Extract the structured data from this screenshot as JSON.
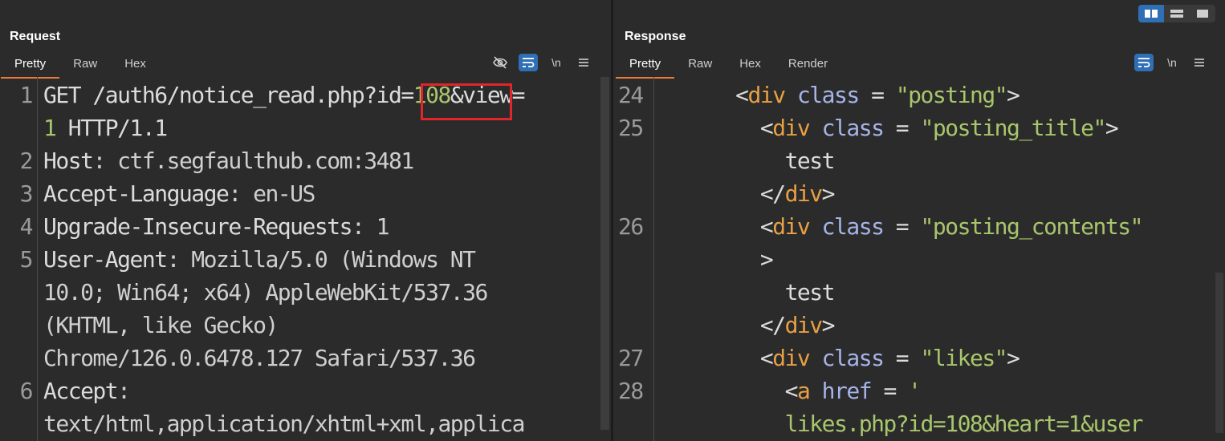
{
  "request": {
    "title": "Request",
    "tabs": [
      "Pretty",
      "Raw",
      "Hex"
    ],
    "icons": [
      "eye-slash-icon",
      "wrap-icon",
      "newline-icon",
      "menu-icon"
    ],
    "newline_label": "\\n",
    "line_numbers": [
      "1",
      "",
      "2",
      "3",
      "4",
      "5",
      "",
      "",
      "",
      "6",
      ""
    ],
    "lines": [
      [
        {
          "t": "GET /auth6/notice_read.php?",
          "c": "k"
        },
        {
          "t": "id=",
          "c": "k"
        },
        {
          "t": "108",
          "c": "g"
        },
        {
          "t": "&view=",
          "c": "k"
        }
      ],
      [
        {
          "t": "1",
          "c": "g"
        },
        {
          "t": " HTTP/1.1",
          "c": "k"
        }
      ],
      [
        {
          "t": "Host",
          "c": "k"
        },
        {
          "t": ": ctf.segfaulthub.com:3481",
          "c": "v"
        }
      ],
      [
        {
          "t": "Accept-Language",
          "c": "k"
        },
        {
          "t": ": en-US",
          "c": "v"
        }
      ],
      [
        {
          "t": "Upgrade-Insecure-Requests",
          "c": "k"
        },
        {
          "t": ": 1",
          "c": "v"
        }
      ],
      [
        {
          "t": "User-Agent",
          "c": "k"
        },
        {
          "t": ": Mozilla/5.0 (Windows NT",
          "c": "v"
        }
      ],
      [
        {
          "t": "10.0; Win64; x64) AppleWebKit/537.36",
          "c": "v"
        }
      ],
      [
        {
          "t": "(KHTML, like Gecko)",
          "c": "v"
        }
      ],
      [
        {
          "t": "Chrome/126.0.6478.127 Safari/537.36",
          "c": "v"
        }
      ],
      [
        {
          "t": "Accept",
          "c": "k"
        },
        {
          "t": ":",
          "c": "v"
        }
      ],
      [
        {
          "t": "text/html,application/xhtml+xml,applica",
          "c": "v"
        }
      ]
    ]
  },
  "response": {
    "title": "Response",
    "tabs": [
      "Pretty",
      "Raw",
      "Hex",
      "Render"
    ],
    "icons": [
      "wrap-icon",
      "newline-icon",
      "menu-icon"
    ],
    "newline_label": "\\n",
    "line_numbers": [
      "24",
      "25",
      "",
      "",
      "26",
      "",
      "",
      "",
      "27",
      "28",
      ""
    ],
    "lines": [
      [
        {
          "t": "      <",
          "c": "punc"
        },
        {
          "t": "div",
          "c": "tag"
        },
        {
          "t": " class",
          "c": "attr"
        },
        {
          "t": " = ",
          "c": "punc"
        },
        {
          "t": "\"posting\"",
          "c": "str"
        },
        {
          "t": ">",
          "c": "punc"
        }
      ],
      [
        {
          "t": "        <",
          "c": "punc"
        },
        {
          "t": "div",
          "c": "tag"
        },
        {
          "t": " class",
          "c": "attr"
        },
        {
          "t": " = ",
          "c": "punc"
        },
        {
          "t": "\"posting_title\"",
          "c": "str"
        },
        {
          "t": ">",
          "c": "punc"
        }
      ],
      [
        {
          "t": "          test",
          "c": "k"
        }
      ],
      [
        {
          "t": "        </",
          "c": "punc"
        },
        {
          "t": "div",
          "c": "tag"
        },
        {
          "t": ">",
          "c": "punc"
        }
      ],
      [
        {
          "t": "        <",
          "c": "punc"
        },
        {
          "t": "div",
          "c": "tag"
        },
        {
          "t": " class",
          "c": "attr"
        },
        {
          "t": " = ",
          "c": "punc"
        },
        {
          "t": "\"posting_contents\"",
          "c": "str"
        }
      ],
      [
        {
          "t": "        >",
          "c": "punc"
        }
      ],
      [
        {
          "t": "          test",
          "c": "k"
        }
      ],
      [
        {
          "t": "        </",
          "c": "punc"
        },
        {
          "t": "div",
          "c": "tag"
        },
        {
          "t": ">",
          "c": "punc"
        }
      ],
      [
        {
          "t": "        <",
          "c": "punc"
        },
        {
          "t": "div",
          "c": "tag"
        },
        {
          "t": " class",
          "c": "attr"
        },
        {
          "t": " = ",
          "c": "punc"
        },
        {
          "t": "\"likes\"",
          "c": "str"
        },
        {
          "t": ">",
          "c": "punc"
        }
      ],
      [
        {
          "t": "          <",
          "c": "punc"
        },
        {
          "t": "a",
          "c": "tag"
        },
        {
          "t": " href",
          "c": "attr"
        },
        {
          "t": " = ",
          "c": "punc"
        },
        {
          "t": "'",
          "c": "str"
        }
      ],
      [
        {
          "t": "          likes.php?id=108&heart=1&user",
          "c": "str"
        }
      ]
    ]
  },
  "layout_buttons": [
    "split-horizontal-icon",
    "split-vertical-icon",
    "single-pane-icon"
  ],
  "colors": {
    "accent_tab": "#e8793a",
    "highlight_box": "#e0262a",
    "toggle_blue": "#2f6fb5"
  }
}
